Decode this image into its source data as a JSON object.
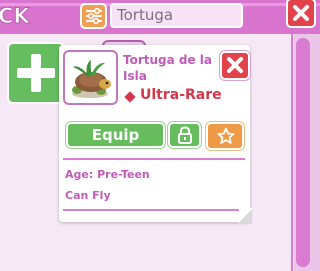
{
  "header": {
    "title_fragment": "CK",
    "search": {
      "value": "Tortuga"
    }
  },
  "pet_popup": {
    "name": "Tortuga de la Isla",
    "rarity": "Ultra-Rare",
    "equip_label": "Equip",
    "info": [
      "Age: Pre-Teen",
      "Can Fly"
    ]
  },
  "icons": {
    "filter": "sliders-icon",
    "close": "close-icon",
    "add": "plus-icon",
    "lock": "padlock-icon",
    "favorite": "star-icon",
    "rarity": "diamond-icon"
  },
  "colors": {
    "header": "#d975cf",
    "close": "#e2434a",
    "equip": "#67bd5e",
    "favorite": "#ee9a47",
    "rarity": "#d8364a",
    "text_accent": "#c15cb9"
  }
}
